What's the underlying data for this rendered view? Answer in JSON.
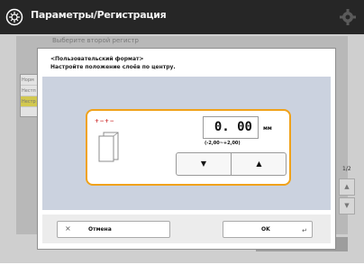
{
  "header": {
    "title": "Параметры/Регистрация"
  },
  "background": {
    "subtitle": "Выберите второй регистр",
    "list_items": [
      "Норм",
      "Нестп",
      "Нестр"
    ],
    "page_indicator": "1/2"
  },
  "dialog": {
    "heading_line1": "<Пользовательский формат>",
    "heading_line2": "Настройте положение слоёв по центру.",
    "setting": {
      "value": "0. 00",
      "unit": "мм",
      "range": "(-2,00~+2,00)",
      "decrement_symbol": "▼",
      "increment_symbol": "▲",
      "indicator": "+−+−"
    },
    "footer": {
      "cancel_icon": "×",
      "cancel_label": "Отмена",
      "ok_label": "OK",
      "enter_icon": "↵"
    }
  },
  "colors": {
    "accent": "#f0a21a",
    "topbar": "#262626",
    "panel": "#cbd2df",
    "selected_row": "#d2c84f",
    "indicator": "#cc2a2a"
  }
}
